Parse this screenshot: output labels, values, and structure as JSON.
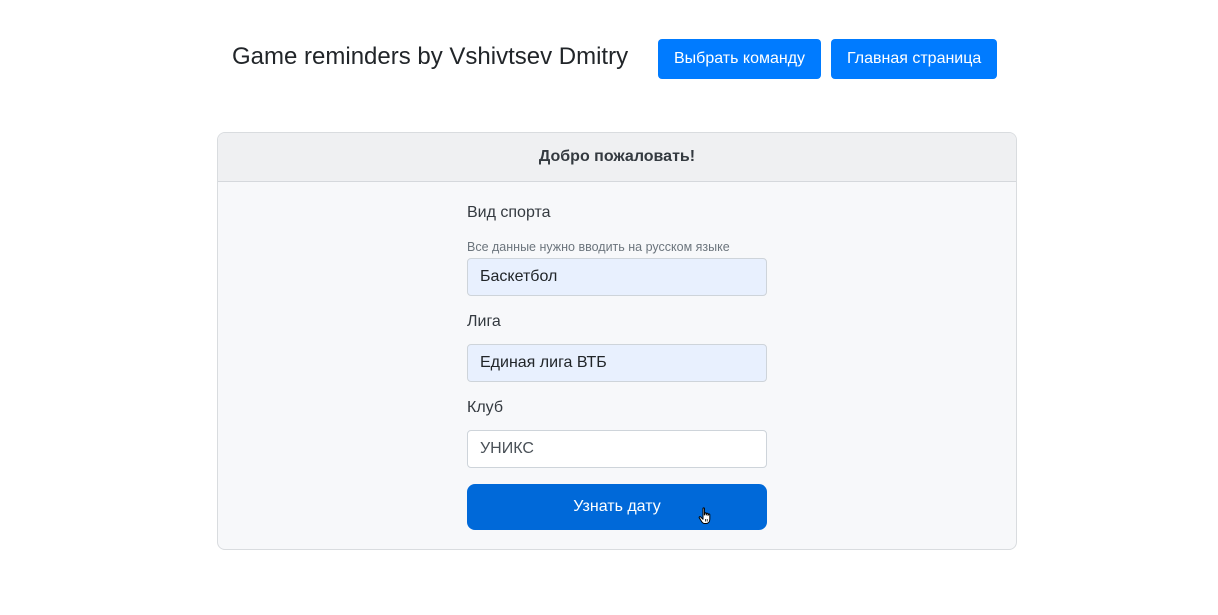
{
  "header": {
    "title": "Game reminders by Vshivtsev Dmitry",
    "choose_team_label": "Выбрать команду",
    "home_label": "Главная страница"
  },
  "card": {
    "title": "Добро пожаловать!",
    "form": {
      "sport_label": "Вид спорта",
      "hint": "Все данные нужно вводить на русском языке",
      "sport_value": "Баскетбол",
      "league_label": "Лига",
      "league_value": "Единая лига ВТБ",
      "club_label": "Клуб",
      "club_value": "УНИКС",
      "submit_label": "Узнать дату"
    }
  },
  "colors": {
    "primary": "#007bff",
    "primary_active": "#0069d9",
    "autofill": "#e8f0fe"
  },
  "icons": {
    "cursor": "hand-pointer-icon"
  }
}
